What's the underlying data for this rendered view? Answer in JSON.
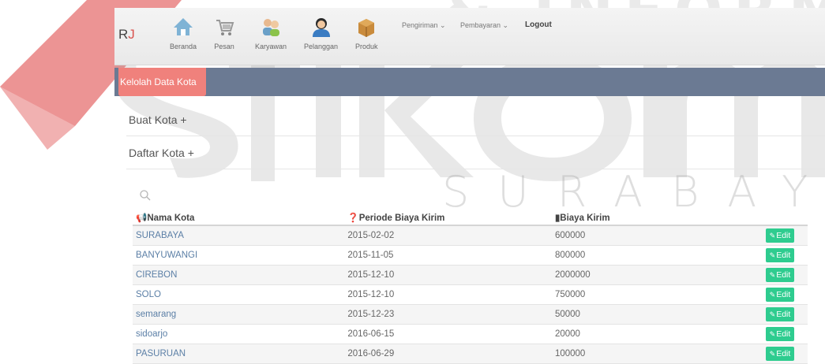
{
  "watermark": {
    "brand_text": "& INFORMATIK",
    "city_text": "SURABAYA"
  },
  "header": {
    "brand_prefix": "R",
    "brand_suffix": "J",
    "nav": [
      {
        "label": "Beranda",
        "icon": "home-icon"
      },
      {
        "label": "Pesan",
        "icon": "cart-icon"
      },
      {
        "label": "Karyawan",
        "icon": "users-icon"
      },
      {
        "label": "Pelanggan",
        "icon": "customer-icon"
      },
      {
        "label": "Produk",
        "icon": "box-icon"
      }
    ],
    "menus": [
      {
        "label": "Pengiriman ⌄"
      },
      {
        "label": "Pembayaran ⌄"
      }
    ],
    "logout": "Logout"
  },
  "banner": {
    "title": "Kelolah Data Kota"
  },
  "sections": {
    "create": "Buat Kota +",
    "list": "Daftar Kota +"
  },
  "table": {
    "headers": [
      "Nama Kota",
      "Periode Biaya Kirim",
      "Biaya Kirim"
    ],
    "edit_label": "Edit",
    "rows": [
      {
        "city": "SURABAYA",
        "period": "2015-02-02",
        "cost": "600000"
      },
      {
        "city": "BANYUWANGI",
        "period": "2015-11-05",
        "cost": "800000"
      },
      {
        "city": "CIREBON",
        "period": "2015-12-10",
        "cost": "2000000"
      },
      {
        "city": "SOLO",
        "period": "2015-12-10",
        "cost": "750000"
      },
      {
        "city": "semarang",
        "period": "2015-12-23",
        "cost": "50000"
      },
      {
        "city": "sidoarjo",
        "period": "2016-06-15",
        "cost": "20000"
      },
      {
        "city": "PASURUAN",
        "period": "2016-06-29",
        "cost": "100000"
      }
    ]
  },
  "colors": {
    "banner": "#6b7a93",
    "banner_tab": "#f0817c",
    "edit_button": "#2ecc8f",
    "city_link": "#5b7fa6"
  }
}
